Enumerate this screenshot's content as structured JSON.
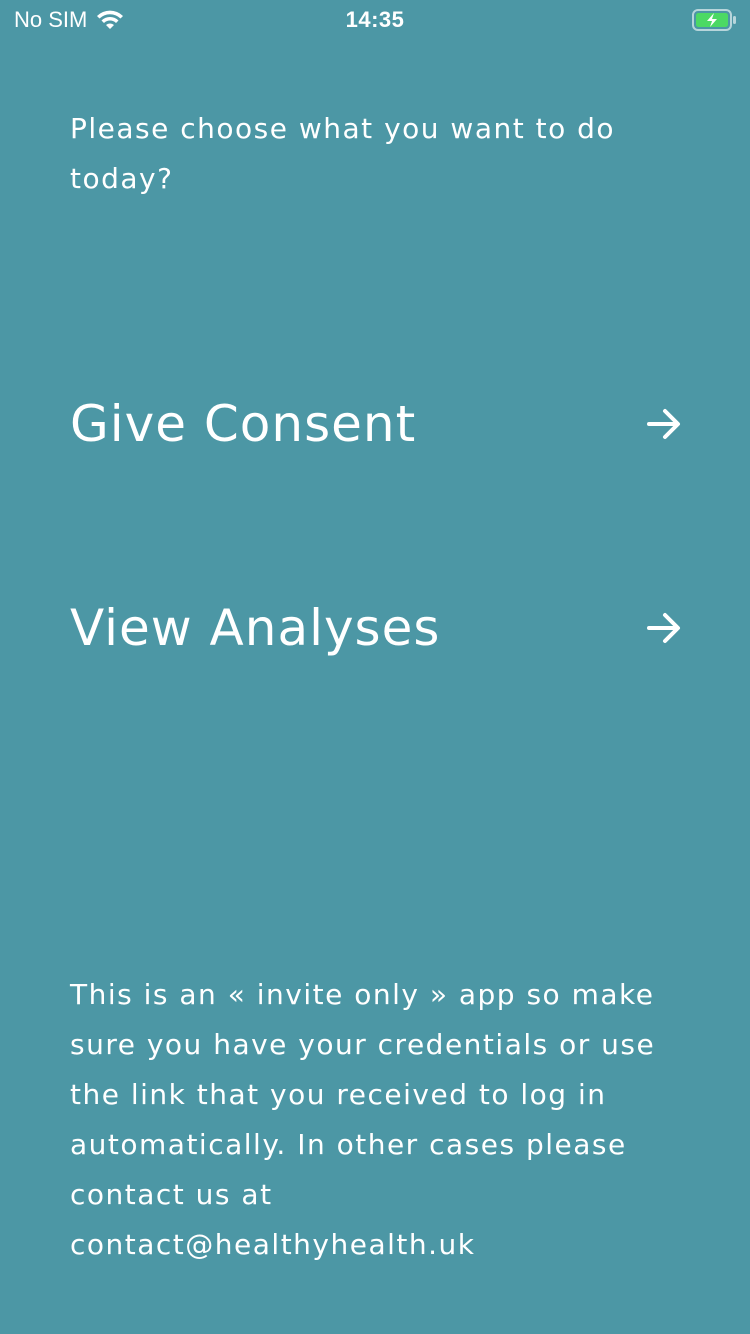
{
  "status_bar": {
    "carrier": "No SIM",
    "time": "14:35",
    "wifi_icon": "wifi-icon",
    "battery_icon": "battery-charging-icon",
    "battery_color": "#4CD964"
  },
  "main": {
    "prompt": "Please choose what you want to do today?",
    "options": [
      {
        "label": "Give Consent",
        "icon": "arrow-right-icon"
      },
      {
        "label": "View Analyses",
        "icon": "arrow-right-icon"
      }
    ]
  },
  "footer": {
    "note": "This is an « invite only » app so make sure you have your credentials or use the link that you received to log in automatically. In other cases please contact us at",
    "email": "contact@healthyhealth.uk"
  },
  "colors": {
    "background": "#4C97A5",
    "text": "#FFFFFF"
  }
}
